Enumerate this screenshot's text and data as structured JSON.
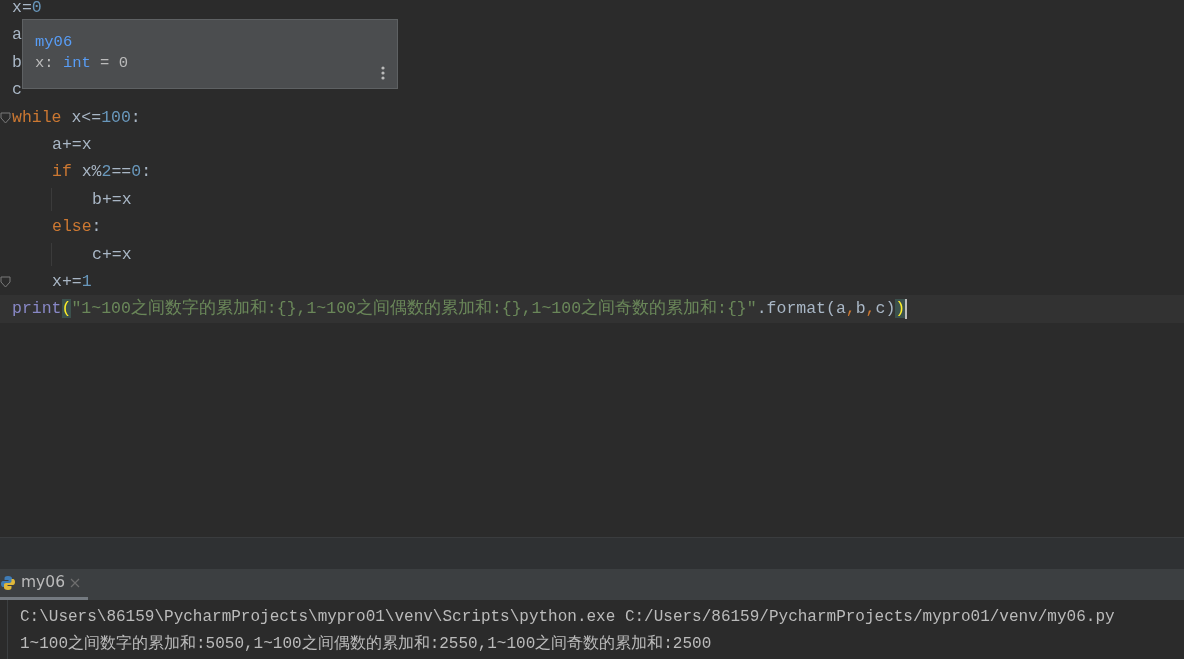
{
  "editor": {
    "lines": [
      {
        "tokens": [
          {
            "kind": "name",
            "text": "x="
          },
          {
            "kind": "number",
            "text": "0"
          }
        ]
      },
      {
        "tokens": [
          {
            "kind": "name",
            "text": "a"
          }
        ]
      },
      {
        "tokens": [
          {
            "kind": "name",
            "text": "b"
          }
        ]
      },
      {
        "tokens": [
          {
            "kind": "name",
            "text": "c"
          }
        ]
      },
      {
        "fold": true,
        "tokens": [
          {
            "kind": "keyword",
            "text": "while"
          },
          {
            "kind": "name",
            "text": " x<="
          },
          {
            "kind": "number",
            "text": "100"
          },
          {
            "kind": "name",
            "text": ":"
          }
        ],
        "children": [
          {
            "tokens": [
              {
                "kind": "name",
                "text": "a+=x"
              }
            ]
          },
          {
            "tokens": [
              {
                "kind": "keyword",
                "text": "if"
              },
              {
                "kind": "name",
                "text": " x%"
              },
              {
                "kind": "number",
                "text": "2"
              },
              {
                "kind": "name",
                "text": "=="
              },
              {
                "kind": "number",
                "text": "0"
              },
              {
                "kind": "name",
                "text": ":"
              }
            ],
            "children": [
              {
                "tokens": [
                  {
                    "kind": "name",
                    "text": "b+=x"
                  }
                ]
              }
            ]
          },
          {
            "tokens": [
              {
                "kind": "keyword",
                "text": "else"
              },
              {
                "kind": "name",
                "text": ":"
              }
            ],
            "children": [
              {
                "tokens": [
                  {
                    "kind": "name",
                    "text": "c+=x"
                  }
                ]
              }
            ]
          },
          {
            "fold": true,
            "tokens": [
              {
                "kind": "name",
                "text": "x+="
              },
              {
                "kind": "number",
                "text": "1"
              }
            ]
          }
        ]
      },
      {
        "current": true,
        "tokens": [
          {
            "kind": "builtin",
            "text": "print"
          },
          {
            "kind": "brace",
            "text": "("
          },
          {
            "kind": "string",
            "text": "\"1~100之间数字的累加和:{},1~100之间偶数的累加和:{},1~100之间奇数的累加和:{}\""
          },
          {
            "kind": "name",
            "text": ".format(a"
          },
          {
            "kind": "comma",
            "text": ","
          },
          {
            "kind": "name",
            "text": "b"
          },
          {
            "kind": "comma",
            "text": ","
          },
          {
            "kind": "name",
            "text": "c)"
          },
          {
            "kind": "brace",
            "text": ")"
          }
        ]
      }
    ]
  },
  "tooltip": {
    "title": "my06",
    "variable": "x:",
    "type": "int",
    "value": "= 0"
  },
  "run_panel": {
    "tabs": [
      {
        "label": "my06",
        "selected": true
      }
    ],
    "output": [
      "C:\\Users\\86159\\PycharmProjects\\mypro01\\venv\\Scripts\\python.exe C:/Users/86159/PycharmProjects/mypro01/venv/my06.py",
      "1~100之间数字的累加和:5050,1~100之间偶数的累加和:2550,1~100之间奇数的累加和:2500"
    ]
  }
}
